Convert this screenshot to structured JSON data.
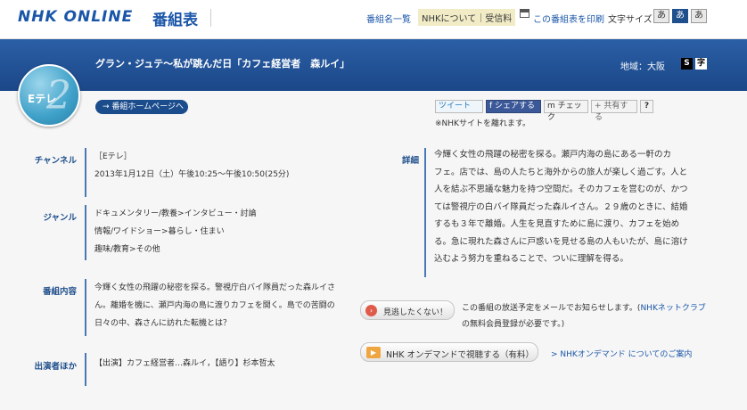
{
  "header": {
    "logo": "NHK ONLINE",
    "logo_sub": "番組表",
    "nav_list": "番組名一覧",
    "nav_about": "NHKについて｜受信料",
    "print": "この番組表を印刷",
    "font_size_label": "文字サイズ",
    "font_sizes": [
      "あ",
      "あ",
      "あ"
    ]
  },
  "band": {
    "title": "グラン・ジュテ〜私が跳んだ日「カフェ経営者　森ルイ」",
    "region": "地域：大阪",
    "s_btn": "S",
    "ji_btn": "字"
  },
  "channel_logo": {
    "text": "Eテレ",
    "num": "2"
  },
  "home_button": "→ 番組ホームページへ",
  "share": {
    "tweet": "ツイート",
    "facebook": "f シェアする",
    "mixi": "m チェック",
    "share": "+ 共有する",
    "help": "?",
    "note": "※NHKサイトを離れます。"
  },
  "info": {
    "channel_label": "チャンネル",
    "channel_value": "［Eテレ］",
    "datetime": "2013年1月12日（土）午後10:25〜午後10:50(25分)",
    "genre_label": "ジャンル",
    "genres": [
      "ドキュメンタリー/教養>インタビュー・討論",
      "情報/ワイドショー>暮らし・住まい",
      "趣味/教育>その他"
    ],
    "content_label": "番組内容",
    "content_lines": [
      "今輝く女性の飛躍の秘密を探る。警視庁白バイ隊員だった森ルイさ",
      "ん。離婚を機に、瀬戸内海の島に渡りカフェを開く。島での苦闘の",
      "日々の中、森さんに訪れた転機とは？"
    ],
    "cast_label": "出演者ほか",
    "cast": "【出演】カフェ経営者…森ルイ，【語り】杉本哲太"
  },
  "detail": {
    "label": "詳細",
    "lines": [
      "今輝く女性の飛躍の秘密を探る。瀬戸内海の島にある一軒のカ",
      "フェ。店では、島の人たちと海外からの旅人が楽しく過ごす。人と",
      "人を結ぶ不思議な魅力を持つ空間だ。そのカフェを営むのが、かつ",
      "ては警視庁の白バイ隊員だった森ルイさん。２９歳のときに、結婚",
      "するも３年で離婚。人生を見直すために島に渡り、カフェを始め",
      "る。急に現れた森さんに戸惑いを見せる島の人もいたが、島に溶け",
      "込むよう努力を重ねることで、ついに理解を得る。"
    ]
  },
  "actions": {
    "nomiss_button": "見逃したくない！",
    "nomiss_note_1": "この番組の放送予定をメールでお知らせします。(",
    "nomiss_link": "NHKネットクラブ",
    "nomiss_note_2": "の無料会員登録が必要です。)",
    "ondemand_button": "NHK オンデマンドで視聴する（有料）",
    "ondemand_link": "> NHKオンデマンド についてのご案内"
  }
}
